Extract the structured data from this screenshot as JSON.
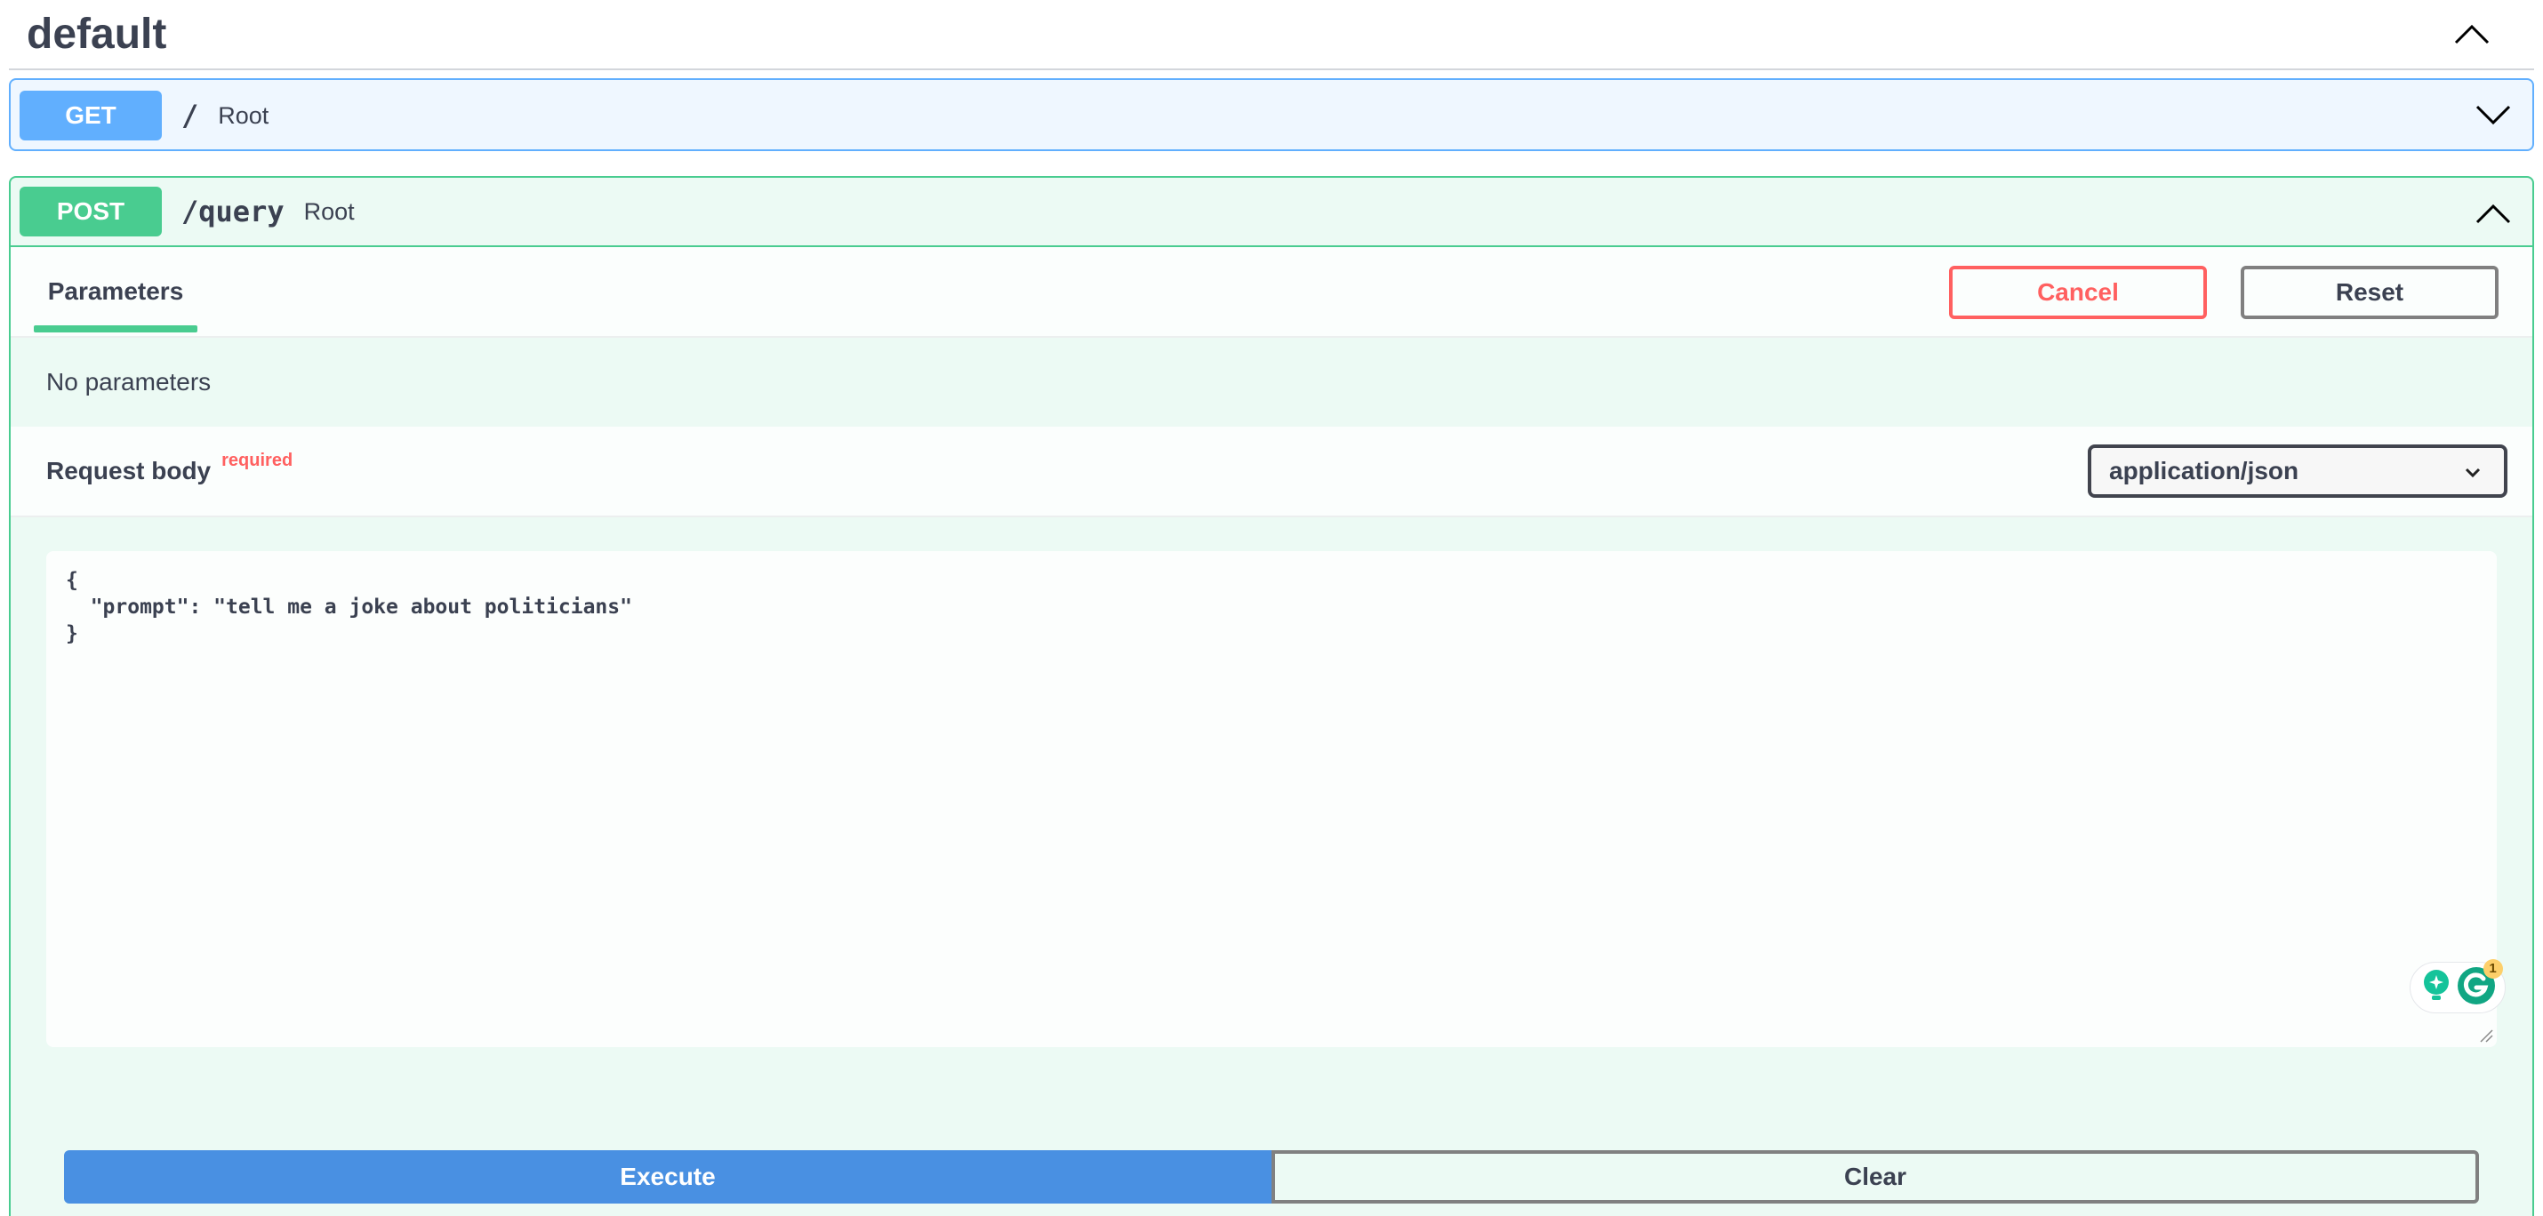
{
  "section": {
    "title": "default"
  },
  "get_op": {
    "method": "GET",
    "path": "/",
    "summary": "Root"
  },
  "post_op": {
    "method": "POST",
    "path": "/query",
    "summary": "Root",
    "tabs": {
      "parameters": "Parameters"
    },
    "buttons": {
      "cancel": "Cancel",
      "reset": "Reset",
      "execute": "Execute",
      "clear": "Clear"
    },
    "no_params": "No parameters",
    "request_body": {
      "title": "Request body",
      "required": "required",
      "content_type": "application/json",
      "editor_text": "{\n  \"prompt\": \"tell me a joke about politicians\"\n}"
    },
    "grammarly": {
      "badge_count": "1"
    }
  },
  "colors": {
    "get": "#61affe",
    "post": "#49cc90",
    "cancel": "#ff6060",
    "execute": "#4990e2",
    "text": "#3b4151"
  }
}
